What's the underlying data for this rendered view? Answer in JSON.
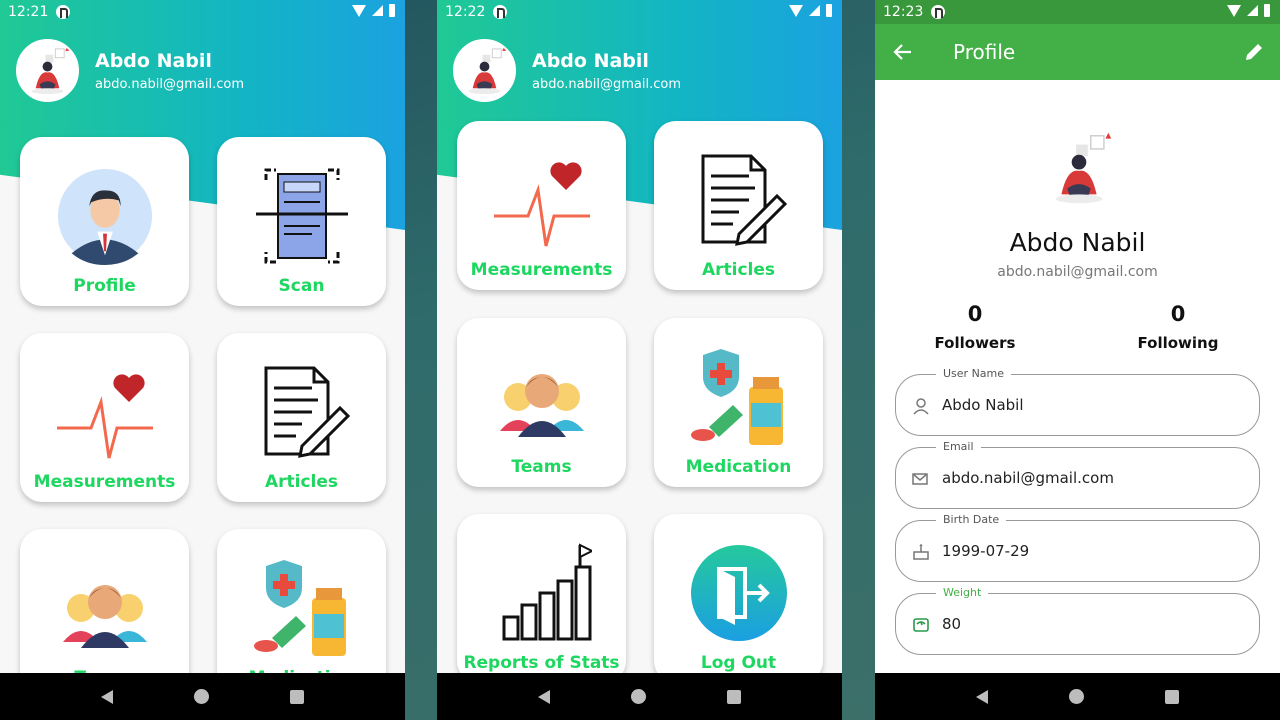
{
  "colors": {
    "accent_green": "#1ed760",
    "gradient_start": "#20c994",
    "gradient_end": "#1ba2e0",
    "appbar": "#43b047"
  },
  "screens": [
    {
      "status": {
        "time": "12:21"
      },
      "user": {
        "name": "Abdo Nabil",
        "email": "abdo.nabil@gmail.com"
      },
      "cards": [
        {
          "label": "Profile",
          "icon": "businessman-icon"
        },
        {
          "label": "Scan",
          "icon": "document-scan-icon"
        },
        {
          "label": "Measurements",
          "icon": "heartbeat-icon"
        },
        {
          "label": "Articles",
          "icon": "article-pen-icon"
        },
        {
          "label": "Teams",
          "icon": "team-people-icon"
        },
        {
          "label": "Medication",
          "icon": "medication-icon"
        }
      ]
    },
    {
      "status": {
        "time": "12:22"
      },
      "user": {
        "name": "Abdo Nabil",
        "email": "abdo.nabil@gmail.com"
      },
      "cards": [
        {
          "label": "Measurements",
          "icon": "heartbeat-icon"
        },
        {
          "label": "Articles",
          "icon": "article-pen-icon"
        },
        {
          "label": "Teams",
          "icon": "team-people-icon"
        },
        {
          "label": "Medication",
          "icon": "medication-icon"
        },
        {
          "label": "Reports of Stats",
          "icon": "stats-chart-icon"
        },
        {
          "label": "Log Out",
          "icon": "logout-door-icon"
        }
      ]
    },
    {
      "status": {
        "time": "12:23"
      },
      "appbar": {
        "title": "Profile"
      },
      "profile": {
        "name": "Abdo Nabil",
        "email": "abdo.nabil@gmail.com",
        "followers_count": "0",
        "followers_label": "Followers",
        "following_count": "0",
        "following_label": "Following"
      },
      "fields": [
        {
          "label": "User Name",
          "value": "Abdo Nabil",
          "icon": "person-icon"
        },
        {
          "label": "Email",
          "value": "abdo.nabil@gmail.com",
          "icon": "mail-icon"
        },
        {
          "label": "Birth Date",
          "value": "1999-07-29",
          "icon": "cake-icon"
        },
        {
          "label": "Weight",
          "value": "80",
          "icon": "scale-icon"
        }
      ]
    }
  ]
}
